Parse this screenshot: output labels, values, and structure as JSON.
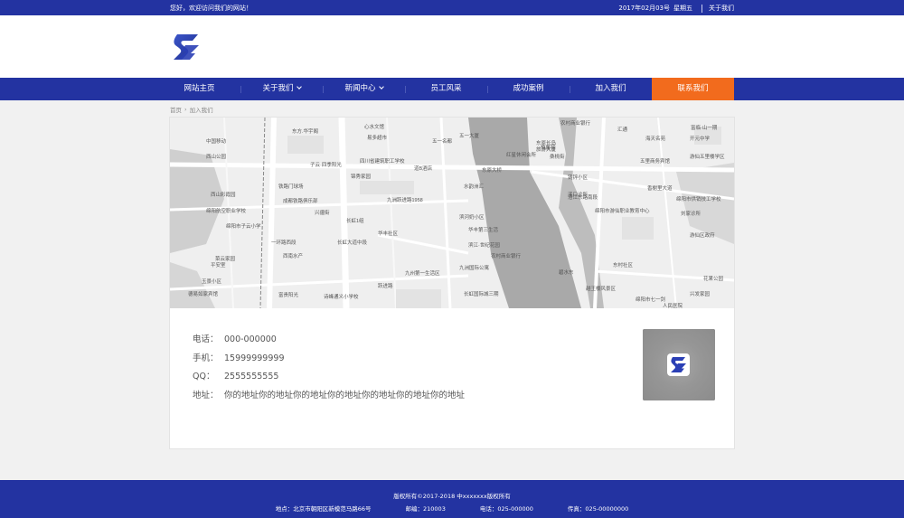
{
  "topbar": {
    "welcome": "您好，欢迎访问我们的网站！",
    "date": "2017年02月03号",
    "weekday": "星期五",
    "about_link": "关于我们"
  },
  "logo": {
    "icon": "s-logo-icon",
    "brand_color": "#2a3fb5"
  },
  "nav": {
    "items": [
      {
        "label": "网站主页"
      },
      {
        "label": "关于我们"
      },
      {
        "label": "新闻中心"
      },
      {
        "label": "员工风采"
      },
      {
        "label": "成功案例"
      },
      {
        "label": "加入我们"
      },
      {
        "label": "联系我们"
      }
    ],
    "active_color": "#f26b1d",
    "bar_color": "#2333a1"
  },
  "breadcrumb": {
    "home": "首页",
    "current": "加入我们"
  },
  "map": {
    "labels": [
      "中国移动",
      "东方.华宇阁",
      "易多超市",
      "五一名都",
      "五一大厦",
      "农村商业银行",
      "富临·山一期",
      "开元中学",
      "心水文馆",
      "汇通",
      "子云·四季阳光",
      "四川省建筑职工学校",
      "红星休闲会所",
      "旅游大厦",
      "东原长岛",
      "海天名苑",
      "道B酒店",
      "恒馨苑",
      "五里商务宾馆",
      "西山公园",
      "铁路门球场",
      "锦秀家园",
      "水韵洲汇",
      "桑桃街",
      "溪口诊所",
      "游仙五里楼学区",
      "成都铁路俱乐部",
      "九洲跃进路1958",
      "东原大桥",
      "铸锌小区",
      "香榭里大道",
      "绵阳航空职业学校",
      "兴疆街",
      "长虹1组",
      "滨河奶小区",
      "涪江东路南段",
      "绵阳市游仙职业教育中心",
      "刘家诊所",
      "西山彩霞园",
      "绵阳市子云小学",
      "华丰社区",
      "华丰第三生活",
      "游仙区政府",
      "滨江·世纪花园",
      "绵阳市供销技工学校",
      "一环路西段",
      "长虹大道中段",
      "西南水产",
      "农村商业银行",
      "平安室",
      "菜云家园",
      "九州第一生活区",
      "九洲国际公寓",
      "东村社区",
      "花果公园",
      "玉景小区",
      "碧水东",
      "长虹国际城三期",
      "越王楼风景区",
      "兴发家园",
      "德易如家宾馆",
      "富贵阳光",
      "诗峰通义小学校",
      "跃进路",
      "绵阳市七一剑",
      "人民医院"
    ]
  },
  "contact": {
    "phone_label": "电话：",
    "phone": "000-000000",
    "mobile_label": "手机：",
    "mobile": "15999999999",
    "qq_label": "QQ：",
    "qq": "2555555555",
    "address_label": "地址：",
    "address": "你的地址你的地址你的地址你的地址你的地址你的地址你的地址"
  },
  "qr": {
    "icon": "qr-code-icon"
  },
  "footer": {
    "copyright": "版权所有©2017-2018 中xxxxxxx版权所有",
    "address": "地点：北京市朝阳区新模范马路66号",
    "postcode": "邮编：210003",
    "phone": "电话：025-000000",
    "fax": "传真：025-00000000"
  }
}
